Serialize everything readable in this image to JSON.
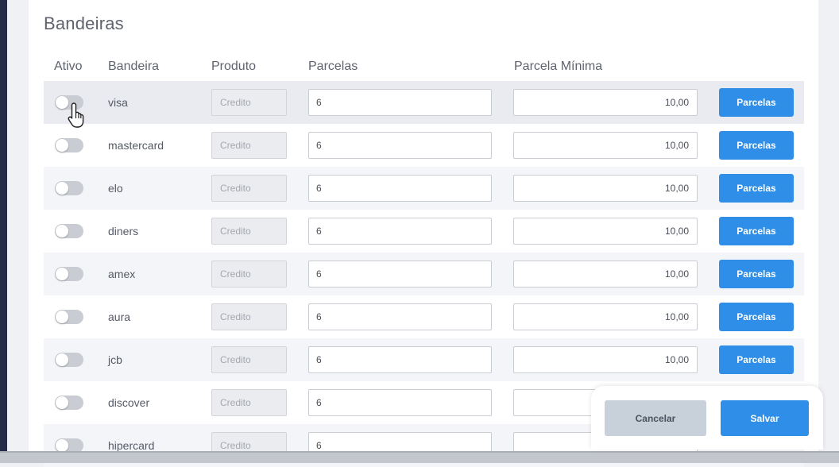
{
  "section": {
    "title": "Bandeiras"
  },
  "columns": {
    "ativo": "Ativo",
    "bandeira": "Bandeira",
    "produto": "Produto",
    "parcelas": "Parcelas",
    "parcela_minima": "Parcela Mínima"
  },
  "rows": [
    {
      "brand": "visa",
      "active": false,
      "product": "Credito",
      "installments": "6",
      "min_installment": "10,00",
      "button": "Parcelas"
    },
    {
      "brand": "mastercard",
      "active": false,
      "product": "Credito",
      "installments": "6",
      "min_installment": "10,00",
      "button": "Parcelas"
    },
    {
      "brand": "elo",
      "active": false,
      "product": "Credito",
      "installments": "6",
      "min_installment": "10,00",
      "button": "Parcelas"
    },
    {
      "brand": "diners",
      "active": false,
      "product": "Credito",
      "installments": "6",
      "min_installment": "10,00",
      "button": "Parcelas"
    },
    {
      "brand": "amex",
      "active": false,
      "product": "Credito",
      "installments": "6",
      "min_installment": "10,00",
      "button": "Parcelas"
    },
    {
      "brand": "aura",
      "active": false,
      "product": "Credito",
      "installments": "6",
      "min_installment": "10,00",
      "button": "Parcelas"
    },
    {
      "brand": "jcb",
      "active": false,
      "product": "Credito",
      "installments": "6",
      "min_installment": "10,00",
      "button": "Parcelas"
    },
    {
      "brand": "discover",
      "active": false,
      "product": "Credito",
      "installments": "6",
      "min_installment": "",
      "button": ""
    },
    {
      "brand": "hipercard",
      "active": false,
      "product": "Credito",
      "installments": "6",
      "min_installment": "",
      "button": ""
    }
  ],
  "footer": {
    "cancel_label": "Cancelar",
    "save_label": "Salvar"
  },
  "colors": {
    "primary": "#2f8fe8",
    "cancel_bg": "#c8d0da",
    "toggle_off": "#c9ccd3",
    "sidebar": "#262a4a"
  },
  "icons": {
    "cursor": "hand-pointer-icon"
  }
}
